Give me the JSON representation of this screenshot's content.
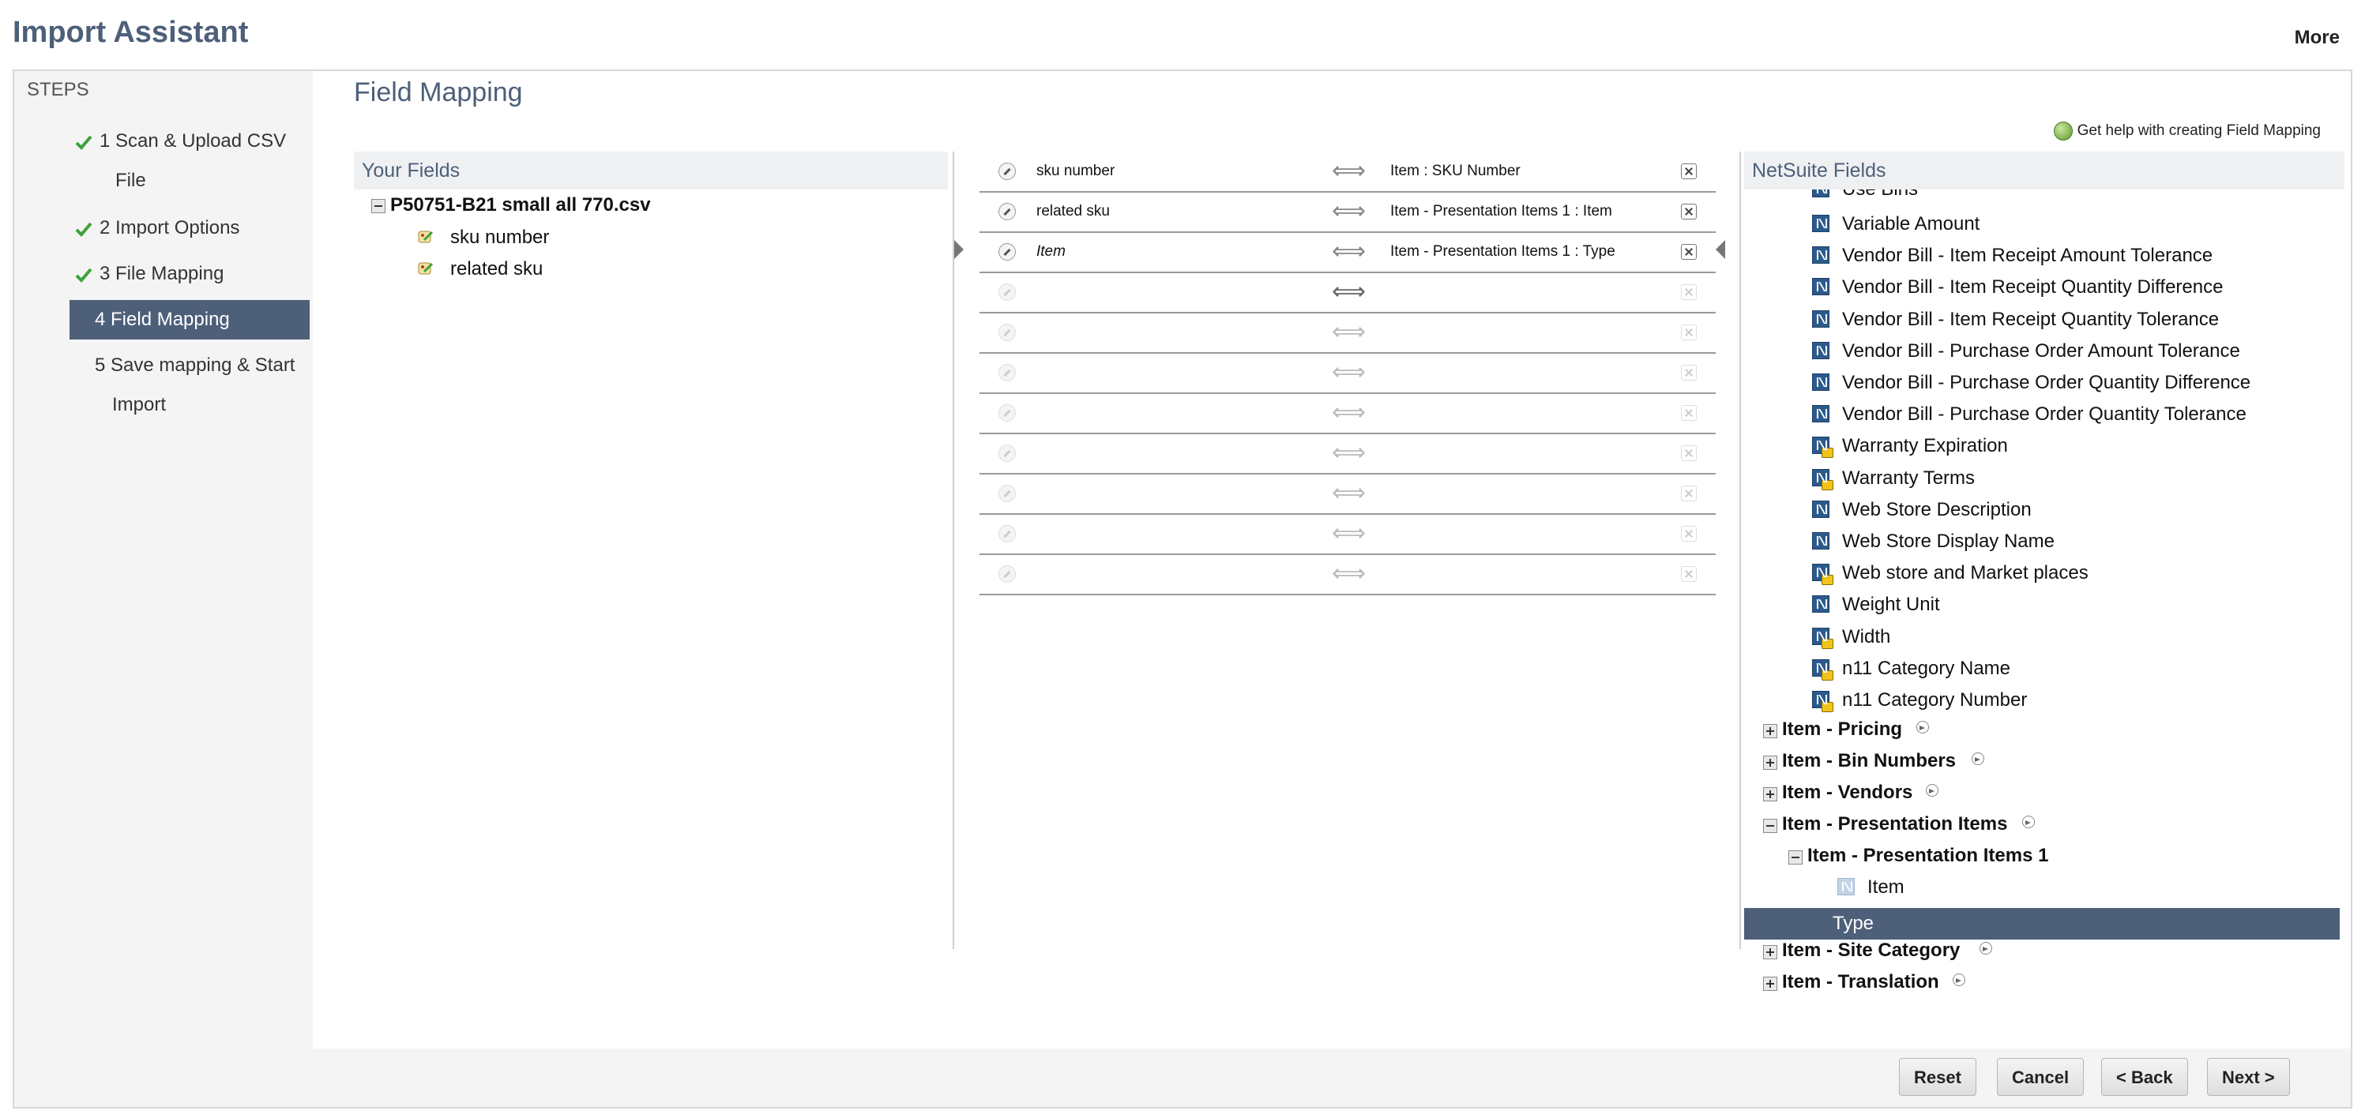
{
  "app": {
    "title": "Import Assistant",
    "more": "More"
  },
  "steps": {
    "title": "STEPS",
    "items": [
      {
        "line1": "1 Scan & Upload CSV",
        "line2": "File",
        "done": true
      },
      {
        "line1": "2 Import Options",
        "done": true
      },
      {
        "line1": "3 File Mapping",
        "done": true
      },
      {
        "line1": "4 Field Mapping",
        "active": true
      },
      {
        "line1": "5 Save mapping & Start",
        "line2": "Import"
      }
    ]
  },
  "page": {
    "title": "Field Mapping",
    "help": "Get help with creating Field Mapping"
  },
  "your_fields": {
    "title": "Your Fields",
    "file": "P50751-B21 small all 770.csv",
    "fields": [
      "sku number",
      "related sku"
    ]
  },
  "mappings": [
    {
      "source": "sku number",
      "target": "Item : SKU Number"
    },
    {
      "source": "related sku",
      "target": "Item - Presentation Items 1 : Item"
    },
    {
      "source": "Item",
      "target": "Item - Presentation Items 1 : Type",
      "italic": true
    }
  ],
  "netsuite": {
    "title": "NetSuite Fields",
    "partial_top": "Use Bins",
    "fields": [
      {
        "label": "Variable Amount",
        "lock": false
      },
      {
        "label": "Vendor Bill - Item Receipt Amount Tolerance",
        "lock": false
      },
      {
        "label": "Vendor Bill - Item Receipt Quantity Difference",
        "lock": false
      },
      {
        "label": "Vendor Bill - Item Receipt Quantity Tolerance",
        "lock": false
      },
      {
        "label": "Vendor Bill - Purchase Order Amount Tolerance",
        "lock": false
      },
      {
        "label": "Vendor Bill - Purchase Order Quantity Difference",
        "lock": false
      },
      {
        "label": "Vendor Bill - Purchase Order Quantity Tolerance",
        "lock": false
      },
      {
        "label": "Warranty Expiration",
        "lock": true
      },
      {
        "label": "Warranty Terms",
        "lock": true
      },
      {
        "label": "Web Store Description",
        "lock": false
      },
      {
        "label": "Web Store Display Name",
        "lock": false
      },
      {
        "label": "Web store and Market places",
        "lock": true
      },
      {
        "label": "Weight Unit",
        "lock": false
      },
      {
        "label": "Width",
        "lock": true
      },
      {
        "label": "n11 Category Name",
        "lock": true
      },
      {
        "label": "n11 Category Number",
        "lock": true
      }
    ],
    "groups": {
      "pricing": "Item - Pricing",
      "bin_numbers": "Item - Bin Numbers",
      "vendors": "Item - Vendors",
      "presentation": "Item - Presentation Items",
      "presentation_1": "Item - Presentation Items 1",
      "presentation_item": "Item",
      "presentation_type": "Type",
      "site_category": "Item - Site Category",
      "translation": "Item - Translation"
    }
  },
  "buttons": {
    "reset": "Reset",
    "cancel": "Cancel",
    "back": "< Back",
    "next": "Next >"
  }
}
